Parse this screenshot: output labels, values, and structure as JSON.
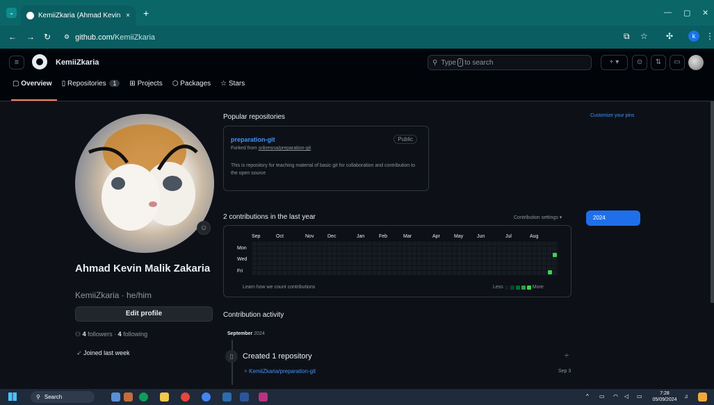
{
  "browser": {
    "tab_title": "KemiiZkaria (Ahmad Kevin Mali",
    "tab_close": "×",
    "new_tab": "+",
    "url_domain": "github.com/",
    "url_path": "KemiiZkaria",
    "profile_initial": "k"
  },
  "github": {
    "owner": "KemiiZkaria",
    "search_prefix": "Type",
    "search_key": "/",
    "search_suffix": "to search",
    "nav": {
      "overview": "Overview",
      "repositories": "Repositories",
      "repositories_count": "1",
      "projects": "Projects",
      "packages": "Packages",
      "stars": "Stars"
    }
  },
  "profile": {
    "name": "Ahmad Kevin Malik Zakaria",
    "login": "KemiiZkaria · he/him",
    "edit_button": "Edit profile",
    "followers_count": "4",
    "followers_label": "followers · ",
    "following_count": "4",
    "following_label": "following",
    "joined": "Joined last week"
  },
  "popular": {
    "title": "Popular repositories",
    "customize": "Customize your pins",
    "repo": {
      "name": "preparation-git",
      "visibility": "Public",
      "forked_label": "Forked from ",
      "forked_from": "srikresna/preparation-git",
      "description": "This is repository for teaching material of basic git for collaboration and contribution to the open source"
    }
  },
  "contributions": {
    "title": "2 contributions in the last year",
    "settings": "Contribution settings ▾",
    "months": [
      "Sep",
      "Oct",
      "Nov",
      "Dec",
      "Jan",
      "Feb",
      "Mar",
      "Apr",
      "May",
      "Jun",
      "Jul",
      "Aug"
    ],
    "days": [
      "Mon",
      "Wed",
      "Fri"
    ],
    "learn": "Learn how we count contributions",
    "less": "Less",
    "more": "More",
    "year": "2024"
  },
  "activity": {
    "title": "Contribution activity",
    "month": "September",
    "year": "2024",
    "item_title": "Created 1 repository",
    "repo": "KemiiZkaria/preparation-git",
    "date": "Sep 3"
  },
  "taskbar": {
    "search": "Search",
    "time": "7:28",
    "date": "05/09/2024"
  },
  "colors": {
    "accent": "#4493f8",
    "contribution_green": "#39d353",
    "year_button": "#1f6feb"
  }
}
